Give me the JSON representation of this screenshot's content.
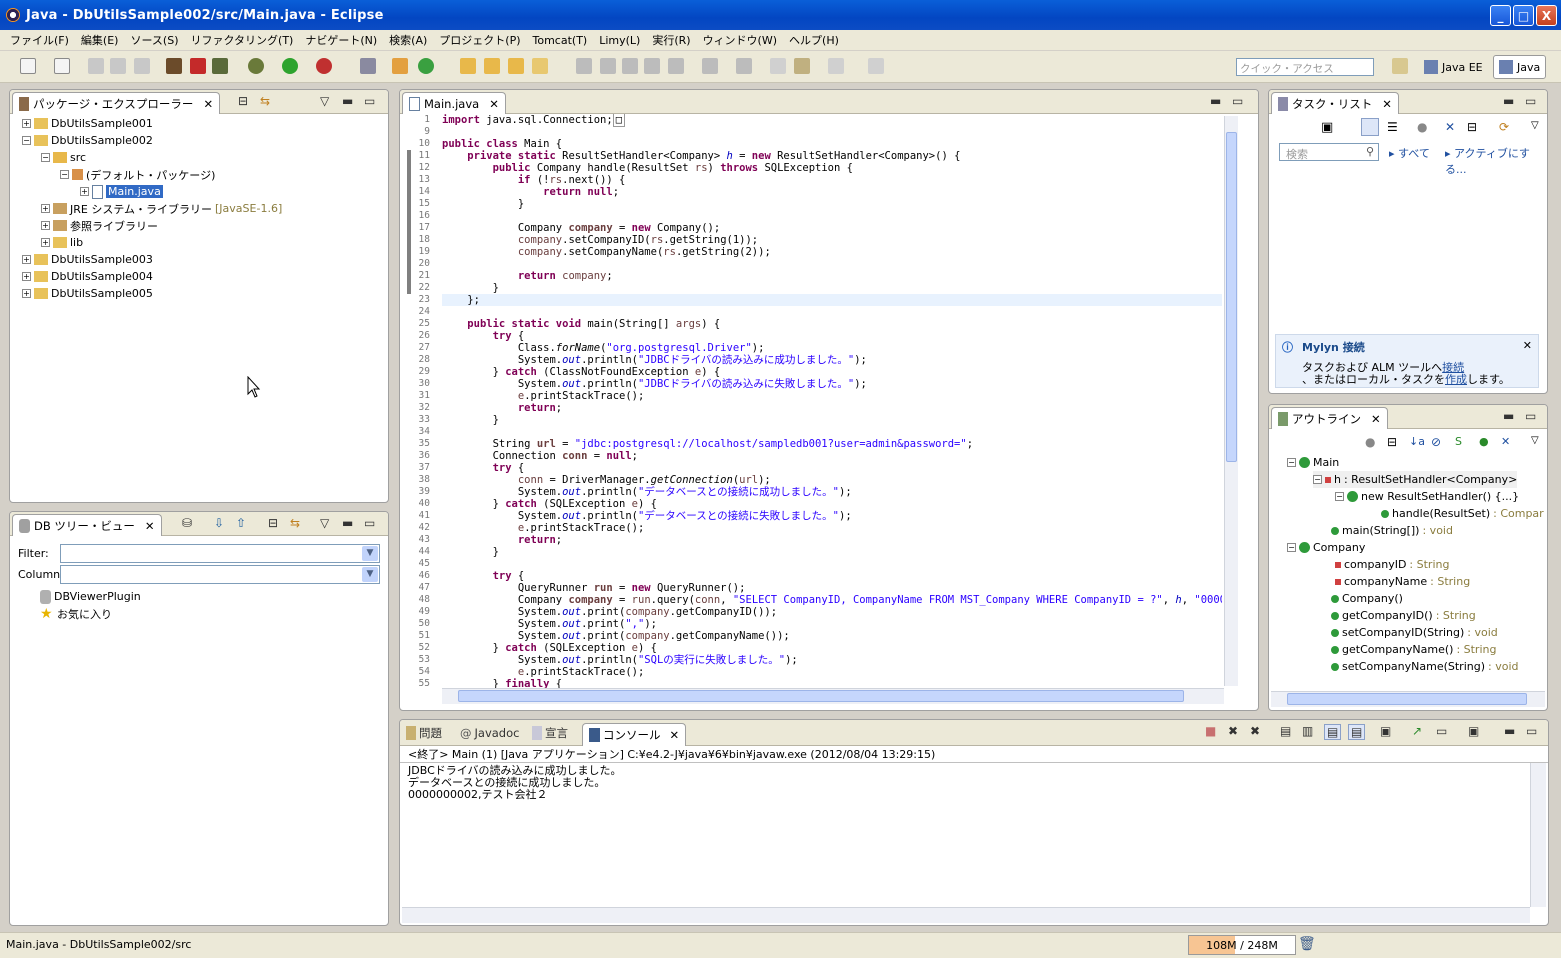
{
  "window": {
    "title": "Java - DbUtilsSample002/src/Main.java - Eclipse",
    "minimize": "_",
    "maximize": "□",
    "close": "X"
  },
  "menu": [
    "ファイル(F)",
    "編集(E)",
    "ソース(S)",
    "リファクタリング(T)",
    "ナビゲート(N)",
    "検索(A)",
    "プロジェクト(P)",
    "Tomcat(T)",
    "Limy(L)",
    "実行(R)",
    "ウィンドウ(W)",
    "ヘルプ(H)"
  ],
  "toolbar": {
    "quick_access_placeholder": "クイック・アクセス",
    "perspectives": [
      "Java EE",
      "Java"
    ]
  },
  "package_explorer": {
    "tab_label": "パッケージ・エクスプローラー",
    "items": [
      {
        "label": "DbUtilsSample001"
      },
      {
        "label": "DbUtilsSample002"
      },
      {
        "label": "src"
      },
      {
        "label": "(デフォルト・パッケージ)"
      },
      {
        "label": "Main.java"
      },
      {
        "label": "JRE システム・ライブラリー",
        "suffix": "[JavaSE-1.6]"
      },
      {
        "label": "参照ライブラリー"
      },
      {
        "label": "lib"
      },
      {
        "label": "DbUtilsSample003"
      },
      {
        "label": "DbUtilsSample004"
      },
      {
        "label": "DbUtilsSample005"
      }
    ]
  },
  "db_tree": {
    "tab_label": "DB ツリー・ビュー",
    "filter_label": "Filter:",
    "column_label": "Column:",
    "items": [
      "DBViewerPlugin",
      "お気に入り"
    ]
  },
  "editor": {
    "tab_label": "Main.java",
    "line_numbers": [
      "1",
      "9",
      "10",
      "11",
      "12",
      "13",
      "14",
      "15",
      "16",
      "17",
      "18",
      "19",
      "20",
      "21",
      "22",
      "23",
      "24",
      "25",
      "26",
      "27",
      "28",
      "29",
      "30",
      "31",
      "32",
      "33",
      "34",
      "35",
      "36",
      "37",
      "38",
      "39",
      "40",
      "41",
      "42",
      "43",
      "44",
      "45",
      "46",
      "47",
      "48",
      "49",
      "50",
      "51",
      "52",
      "53",
      "54",
      "55"
    ]
  },
  "task_list": {
    "tab_label": "タスク・リスト",
    "search_placeholder": "検索",
    "all_label": "すべて",
    "active_label": "アクティブにする...",
    "mylyn_title": "Mylyn 接続",
    "mylyn_line1_a": "タスクおよび ALM ツールへ",
    "mylyn_line1_link": "接続",
    "mylyn_line2_a": "、またはローカル・タスクを",
    "mylyn_line2_link": "作成",
    "mylyn_line2_b": "します。"
  },
  "outline": {
    "tab_label": "アウトライン",
    "items": [
      {
        "name": "Main",
        "type": ""
      },
      {
        "name": "h",
        "type": " : ResultSetHandler<Company>"
      },
      {
        "name": "new ResultSetHandler() {...}",
        "type": ""
      },
      {
        "name": "handle(ResultSet)",
        "type": " : Compar"
      },
      {
        "name": "main(String[])",
        "type": " : void"
      },
      {
        "name": "Company",
        "type": ""
      },
      {
        "name": "companyID",
        "type": " : String"
      },
      {
        "name": "companyName",
        "type": " : String"
      },
      {
        "name": "Company()",
        "type": ""
      },
      {
        "name": "getCompanyID()",
        "type": " : String"
      },
      {
        "name": "setCompanyID(String)",
        "type": " : void"
      },
      {
        "name": "getCompanyName()",
        "type": " : String"
      },
      {
        "name": "setCompanyName(String)",
        "type": " : void"
      }
    ]
  },
  "console": {
    "tabs": [
      "問題",
      "Javadoc",
      "宣言",
      "コンソール"
    ],
    "header": "<終了> Main (1) [Java アプリケーション] C:¥e4.2-J¥java¥6¥bin¥javaw.exe (2012/08/04 13:29:15)",
    "lines": [
      "JDBCドライバの読み込みに成功しました。",
      "データベースとの接続に成功しました。",
      "0000000002,テスト会社２"
    ]
  },
  "status": {
    "path": "Main.java - DbUtilsSample002/src",
    "heap": "108M / 248M",
    "heap_used_fraction": 0.435
  }
}
